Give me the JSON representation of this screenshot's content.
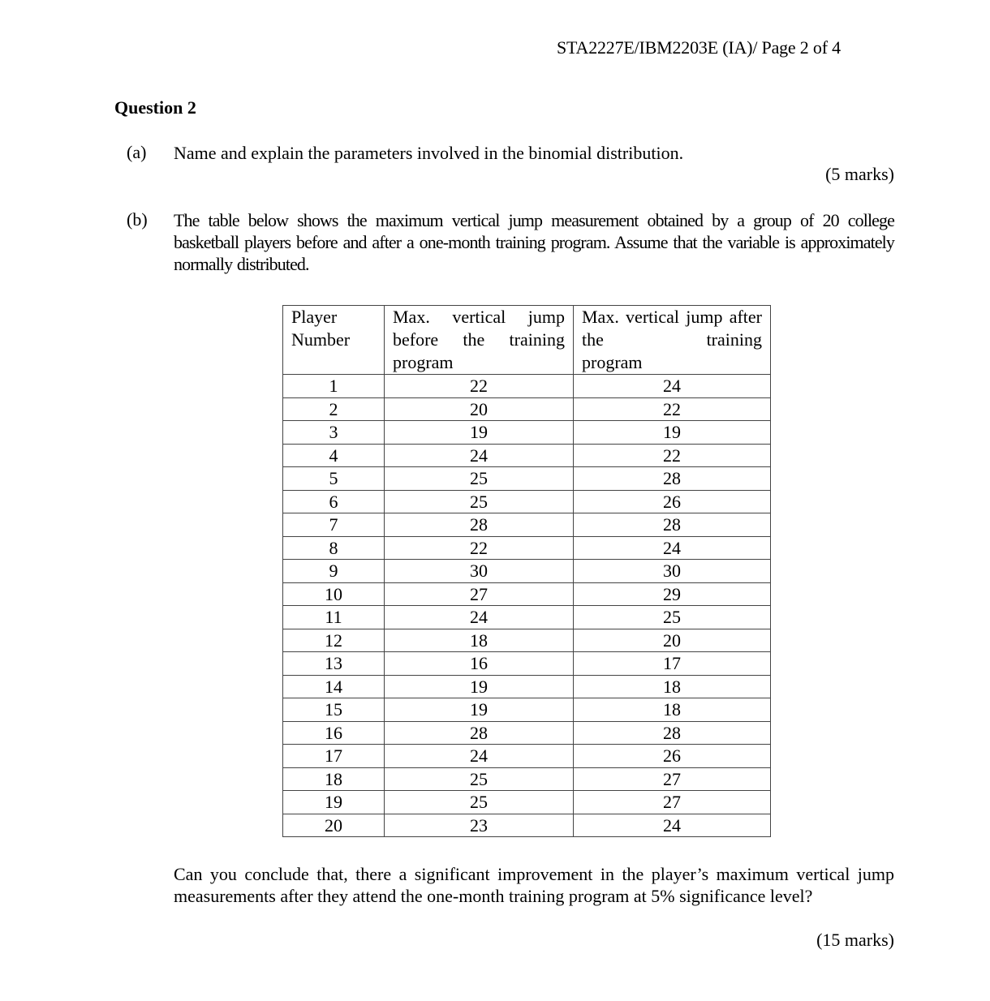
{
  "header": {
    "course_page": "STA2227E/IBM2203E (IA)/ Page 2 of 4"
  },
  "question": {
    "title": "Question 2",
    "part_a": {
      "label": "(a)",
      "text": "Name and explain the parameters involved in the binomial distribution.",
      "marks": "(5 marks)"
    },
    "part_b": {
      "label": "(b)",
      "intro": "The table below shows the maximum vertical jump measurement obtained by a group of 20 college basketball players before and after a one-month training program.  Assume that the variable is approximately normally distributed.",
      "question": "Can you conclude that, there a significant improvement in the player’s maximum vertical jump measurements after they attend the one-month training program at 5% significance level?",
      "marks": "(15 marks)"
    }
  },
  "table": {
    "headers": {
      "player": {
        "line1": "Player",
        "line2": "Number"
      },
      "before": {
        "main": "Max. vertical jump before the training",
        "last": "program"
      },
      "after": {
        "main": "Max. vertical jump after the training",
        "last": "program"
      }
    },
    "rows": [
      {
        "player": "1",
        "before": "22",
        "after": "24"
      },
      {
        "player": "2",
        "before": "20",
        "after": "22"
      },
      {
        "player": "3",
        "before": "19",
        "after": "19"
      },
      {
        "player": "4",
        "before": "24",
        "after": "22"
      },
      {
        "player": "5",
        "before": "25",
        "after": "28"
      },
      {
        "player": "6",
        "before": "25",
        "after": "26"
      },
      {
        "player": "7",
        "before": "28",
        "after": "28"
      },
      {
        "player": "8",
        "before": "22",
        "after": "24"
      },
      {
        "player": "9",
        "before": "30",
        "after": "30"
      },
      {
        "player": "10",
        "before": "27",
        "after": "29"
      },
      {
        "player": "11",
        "before": "24",
        "after": "25"
      },
      {
        "player": "12",
        "before": "18",
        "after": "20"
      },
      {
        "player": "13",
        "before": "16",
        "after": "17"
      },
      {
        "player": "14",
        "before": "19",
        "after": "18"
      },
      {
        "player": "15",
        "before": "19",
        "after": "18"
      },
      {
        "player": "16",
        "before": "28",
        "after": "28"
      },
      {
        "player": "17",
        "before": "24",
        "after": "26"
      },
      {
        "player": "18",
        "before": "25",
        "after": "27"
      },
      {
        "player": "19",
        "before": "25",
        "after": "27"
      },
      {
        "player": "20",
        "before": "23",
        "after": "24"
      }
    ]
  }
}
